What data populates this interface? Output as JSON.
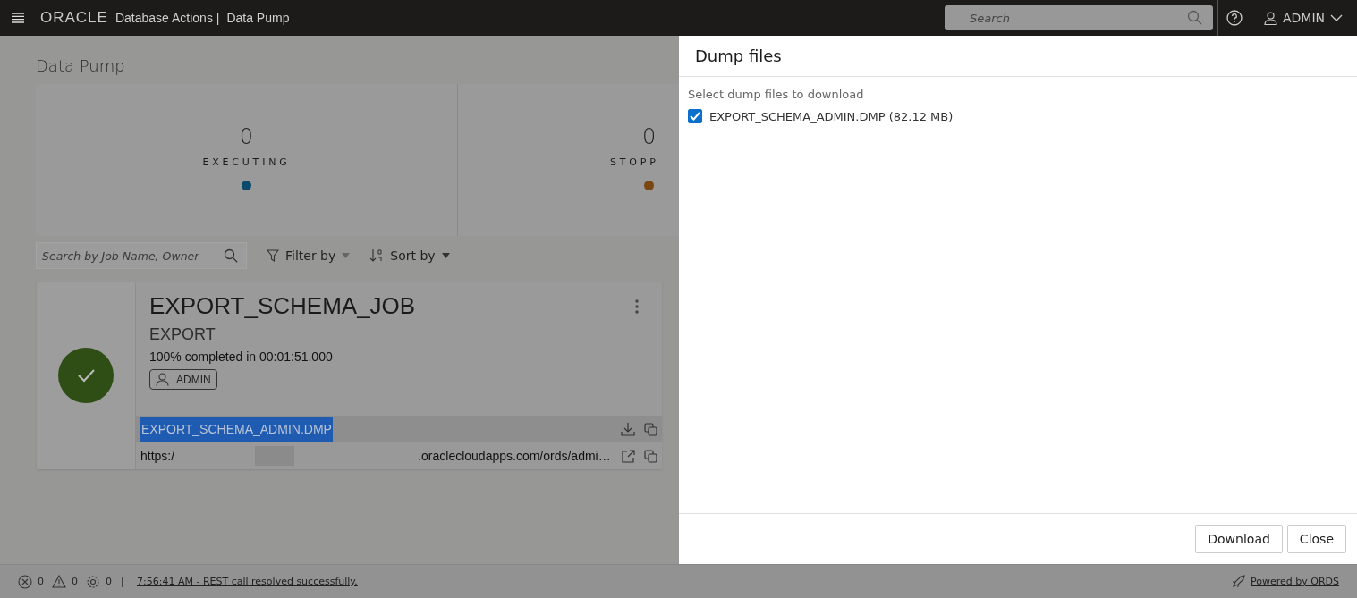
{
  "header": {
    "logo": "ORACLE",
    "app": "Database Actions |",
    "page": "Data Pump",
    "search": {
      "placeholder": "Search"
    },
    "user": "ADMIN"
  },
  "page_title": "Data Pump",
  "stats": [
    {
      "count": "0",
      "label": "EXECUTING",
      "color": "#0b4a6a"
    },
    {
      "count": "0",
      "label": "STOPP",
      "color": "#7a4712"
    }
  ],
  "toolbar": {
    "search": {
      "placeholder": "Search by Job Name, Owner"
    },
    "filter": "Filter by",
    "sort": "Sort by"
  },
  "job": {
    "name": "EXPORT_SCHEMA_JOB",
    "type": "EXPORT",
    "progress": "100% completed in 00:01:51.000",
    "owner": "ADMIN",
    "file": {
      "name": "EXPORT_SCHEMA_ADMIN.DMP",
      "highlighted": true
    },
    "url_start": "https:/",
    "url_end": ".oraclecloudapps.com/ords/admi…"
  },
  "drawer": {
    "title": "Dump files",
    "prompt": "Select dump files to download",
    "files": [
      {
        "label": "EXPORT_SCHEMA_ADMIN.DMP (82.12 MB)",
        "checked": true
      }
    ],
    "buttons": [
      "Download",
      "Close"
    ]
  },
  "status_bar": {
    "errors": "0",
    "warnings": "0",
    "jobs": "0",
    "message": "7:56:41 AM - REST call resolved successfully.",
    "powered": "Powered by ORDS"
  }
}
